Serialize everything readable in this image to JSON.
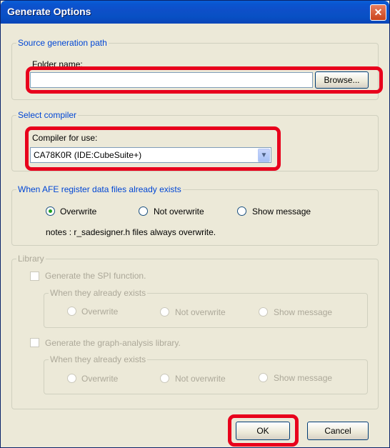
{
  "window": {
    "title": "Generate Options",
    "close_glyph": "✕"
  },
  "source": {
    "legend": "Source generation path",
    "folder_label": "Folder name:",
    "folder_value": "",
    "browse_label": "Browse..."
  },
  "compiler": {
    "legend": "Select compiler",
    "label": "Compiler for use:",
    "selected": "CA78K0R (IDE:CubeSuite+)"
  },
  "afe": {
    "legend": "When AFE register data files already exists",
    "options": [
      "Overwrite",
      "Not overwrite",
      "Show message"
    ],
    "selected_index": 0,
    "note": "notes : r_sadesigner.h files always overwrite."
  },
  "library": {
    "legend": "Library",
    "spi": {
      "checkbox_label": "Generate the SPI function.",
      "group_legend": "When they already exists",
      "options": [
        "Overwrite",
        "Not overwrite",
        "Show message"
      ]
    },
    "graph": {
      "checkbox_label": "Generate the graph-analysis library.",
      "group_legend": "When they already exists",
      "options": [
        "Overwrite",
        "Not overwrite",
        "Show message"
      ]
    }
  },
  "buttons": {
    "ok": "OK",
    "cancel": "Cancel"
  },
  "colors": {
    "highlight": "#e8001c",
    "legend": "#0046d5",
    "disabled": "#aca899"
  }
}
